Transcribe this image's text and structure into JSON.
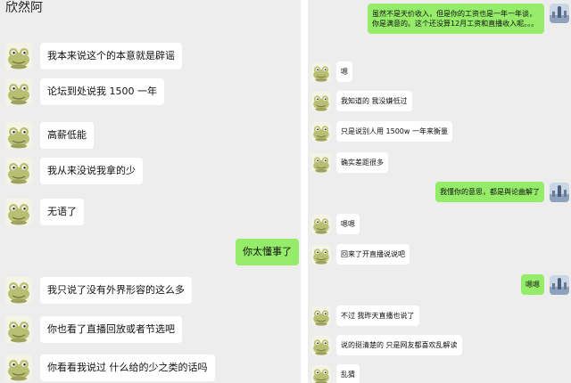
{
  "colors": {
    "background": "#ededed",
    "incoming_bubble": "#ffffff",
    "outgoing_bubble": "#95ec69"
  },
  "left_chat": {
    "title": "欣然阿",
    "messages": [
      {
        "from": "other",
        "text": "我本来说这个的本意就是辟谣"
      },
      {
        "from": "other",
        "text": "论坛到处说我 1500 一年"
      },
      {
        "from": "other",
        "text": "高薪低能"
      },
      {
        "from": "other",
        "text": "我从来没说我拿的少"
      },
      {
        "from": "other",
        "text": "无语了"
      },
      {
        "from": "me",
        "text": "你太懂事了"
      },
      {
        "from": "other",
        "text": "我只说了没有外界形容的这么多"
      },
      {
        "from": "other",
        "text": "你也看了直播回放或者节选吧"
      },
      {
        "from": "other",
        "text": "你看看我说过 什么给的少之类的话吗"
      }
    ]
  },
  "right_chat": {
    "messages": [
      {
        "from": "me",
        "text": "虽然不是天价收入，但是你的工资也是一年一年谈，你是满意的。这个还没算12月工资和直播收入呢。。。"
      },
      {
        "from": "other",
        "text": "嗯"
      },
      {
        "from": "other",
        "text": "我知道的 我没嫌低过"
      },
      {
        "from": "other",
        "text": "只是说别人用 1500w 一年来衡量"
      },
      {
        "from": "other",
        "text": "确实差距很多"
      },
      {
        "from": "me",
        "text": "我懂你的意思，都是舆论曲解了"
      },
      {
        "from": "other",
        "text": "嗯嗯"
      },
      {
        "from": "other",
        "text": "回来了开直播说说吧"
      },
      {
        "from": "me",
        "text": "嗯嗯"
      },
      {
        "from": "other",
        "text": "不过 我昨天直播也说了"
      },
      {
        "from": "other",
        "text": "说的挺清楚的 只是网友都喜欢乱解读"
      },
      {
        "from": "other",
        "text": "乱猜"
      }
    ]
  }
}
